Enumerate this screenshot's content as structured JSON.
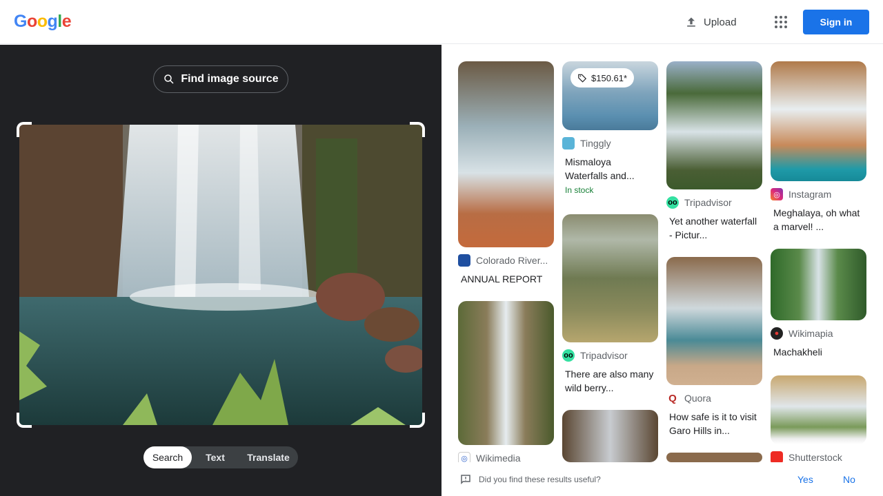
{
  "header": {
    "logo": "Google",
    "upload_label": "Upload",
    "signin_label": "Sign in"
  },
  "query_panel": {
    "find_source_label": "Find image source",
    "tabs": [
      {
        "label": "Search",
        "active": true
      },
      {
        "label": "Text",
        "active": false
      },
      {
        "label": "Translate",
        "active": false
      }
    ]
  },
  "results": {
    "col1": [
      {
        "source": "Colorado River...",
        "title": "ANNUAL REPORT"
      },
      {
        "source": "Wikimedia",
        "title": ""
      }
    ],
    "col2": [
      {
        "price": "$150.61*",
        "source": "Tinggly",
        "title": "Mismaloya Waterfalls and...",
        "stock": "In stock"
      },
      {
        "source": "Tripadvisor",
        "title": "There are also many wild berry..."
      },
      {
        "source": "",
        "title": ""
      }
    ],
    "col3": [
      {
        "source": "Tripadvisor",
        "title": "Yet another waterfall - Pictur..."
      },
      {
        "source": "Quora",
        "title": "How safe is it to visit Garo Hills in..."
      },
      {
        "source": "",
        "title": ""
      }
    ],
    "col4": [
      {
        "source": "Instagram",
        "title": "Meghalaya, oh what a marvel! ..."
      },
      {
        "source": "Wikimapia",
        "title": "Machakheli"
      },
      {
        "source": "Shutterstock",
        "title": ""
      }
    ]
  },
  "footer": {
    "question": "Did you find these results useful?",
    "yes": "Yes",
    "no": "No"
  },
  "colors": {
    "accent": "#1a73e8",
    "dark_panel": "#202124",
    "in_stock": "#188038"
  }
}
